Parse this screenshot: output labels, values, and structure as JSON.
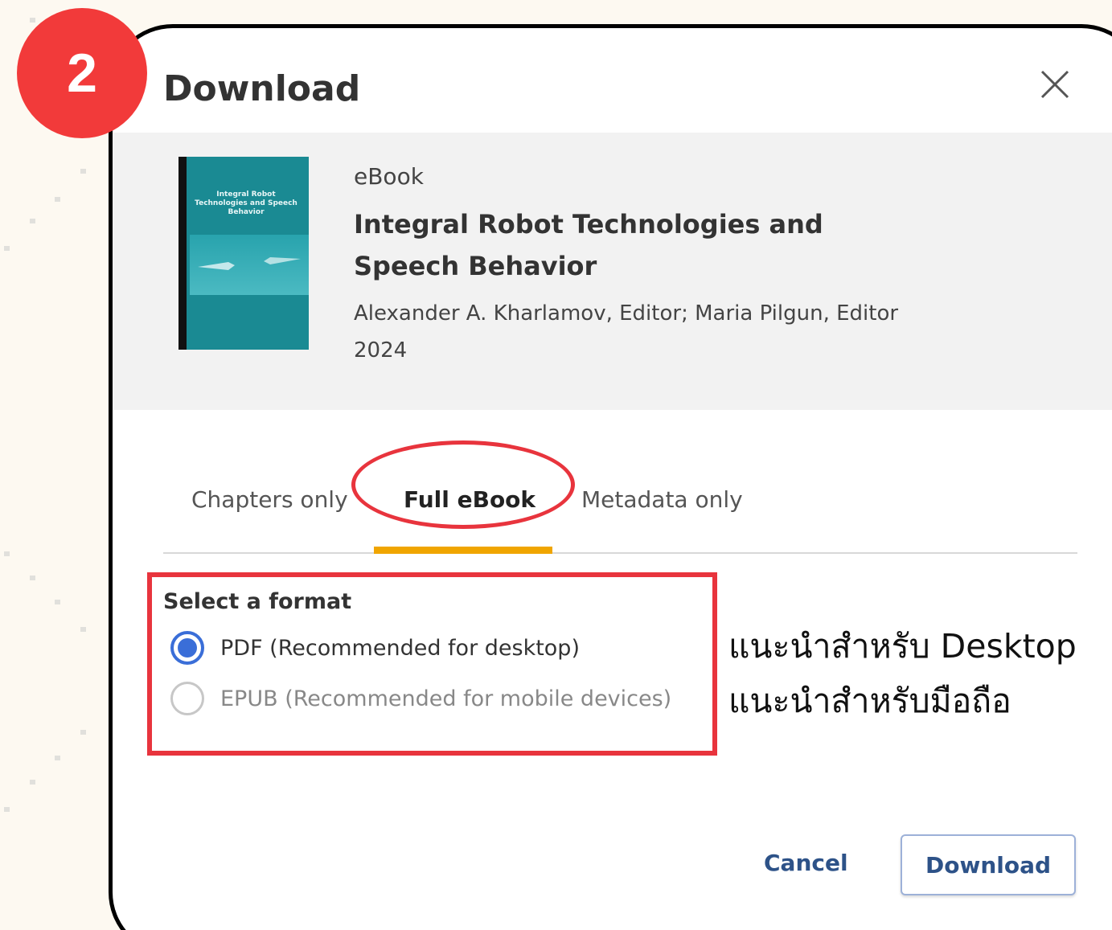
{
  "step_number": "2",
  "dialog": {
    "title": "Download",
    "close_icon": "close-icon"
  },
  "book": {
    "type": "eBook",
    "title": "Integral Robot Technologies and Speech Behavior",
    "authors": "Alexander A. Kharlamov, Editor; Maria Pilgun, Editor",
    "year": "2024",
    "cover_title": "Integral Robot Technologies and Speech Behavior",
    "cover_color": "#1a8a93"
  },
  "tabs": [
    {
      "label": "Chapters only",
      "active": false
    },
    {
      "label": "Full eBook",
      "active": true
    },
    {
      "label": "Metadata only",
      "active": false
    }
  ],
  "format": {
    "heading": "Select a format",
    "options": [
      {
        "label": "PDF (Recommended for desktop)",
        "selected": true
      },
      {
        "label": "EPUB (Recommended for mobile devices)",
        "selected": false
      }
    ]
  },
  "annotations": {
    "desktop_note": "แนะนำสำหรับ Desktop",
    "mobile_note": "แนะนำสำหรับมือถือ",
    "highlight_color": "#e8343d",
    "badge_color": "#f23a3a"
  },
  "buttons": {
    "cancel": "Cancel",
    "download": "Download"
  },
  "colors": {
    "accent_tab": "#f0a500",
    "radio_selected": "#3a6ed8",
    "button_text": "#2d5288"
  }
}
